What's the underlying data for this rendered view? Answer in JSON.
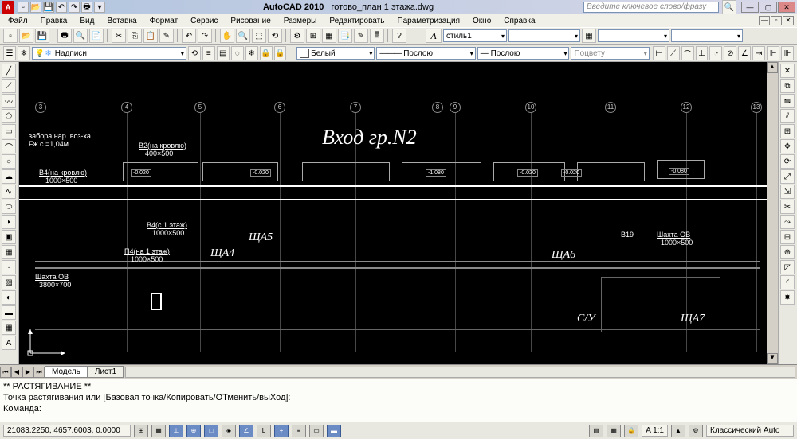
{
  "titlebar": {
    "app": "AutoCAD 2010",
    "file": "готово_план 1 этажа.dwg",
    "search_placeholder": "Введите ключевое слово/фразу"
  },
  "menu": {
    "items": [
      "Файл",
      "Правка",
      "Вид",
      "Вставка",
      "Формат",
      "Сервис",
      "Рисование",
      "Размеры",
      "Редактировать",
      "Параметризация",
      "Окно",
      "Справка"
    ]
  },
  "toolbar2": {
    "style_combo": "стиль1",
    "a_label": "A"
  },
  "layerbar": {
    "layer_combo": "Надписи",
    "color_combo": "Белый",
    "ltype_combo": "Послою",
    "lweight_combo": "Послою",
    "plotstyle_combo": "Поцвету"
  },
  "canvas": {
    "main_title": "Вход гр.N2",
    "labels": {
      "l1": "забора нар. воз-ха",
      "l2": "Fж.с.=1,04м",
      "l3": "В2(на кровлю)",
      "l3d": "400×500",
      "l4": "В4(на кровлю)",
      "l4d": "1000×500",
      "l5": "В4(с 1 этаж)",
      "l5d": "1000×500",
      "l6": "П4(на 1 этаж)",
      "l6d": "1000×500",
      "sha4": "ЩА4",
      "sha5": "ЩА5",
      "sha6": "ЩА6",
      "sha7": "ЩА7",
      "ov1": "Шахта ОВ",
      "ov1d": "3800×700",
      "b19": "В19",
      "ov2": "Шахта ОВ",
      "ov2d": "1000×500",
      "su": "С/У",
      "elev1": "-0.020",
      "elev2": "-0.020",
      "elev3": "-1.080",
      "elev4": "-0.020",
      "elev5": "-0.020",
      "elev6": "-0.080"
    },
    "grid_nums": [
      "3",
      "4",
      "5",
      "6",
      "7",
      "8",
      "9",
      "10",
      "11",
      "12",
      "13"
    ]
  },
  "tabs": {
    "model": "Модель",
    "sheet1": "Лист1"
  },
  "cmd": {
    "line1": "** РАСТЯГИВАНИЕ **",
    "line2": "Точка растягивания или [Базовая точка/Копировать/ОТменить/выХод]:",
    "prompt": "Команда:"
  },
  "status": {
    "coords": "21083.2250, 4657.6003, 0.0000",
    "scale": "A 1:1",
    "mode": "Классический Auto"
  }
}
